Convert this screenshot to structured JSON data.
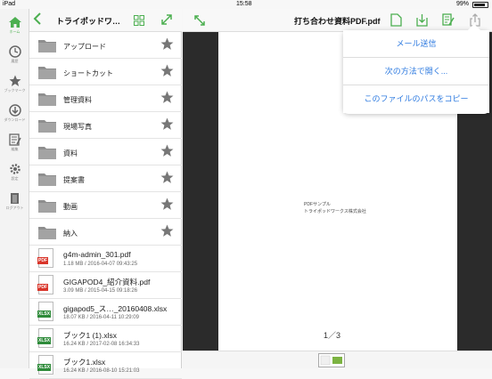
{
  "status": {
    "device": "iPad",
    "time": "15:58",
    "battery": "99%"
  },
  "sidebar": {
    "items": [
      {
        "label": "ホーム",
        "icon": "home-icon"
      },
      {
        "label": "履歴",
        "icon": "clock-icon"
      },
      {
        "label": "ブックマーク",
        "icon": "star-icon"
      },
      {
        "label": "ダウンロード",
        "icon": "download-icon"
      },
      {
        "label": "編集",
        "icon": "edit-icon"
      },
      {
        "label": "設定",
        "icon": "gear-icon"
      },
      {
        "label": "ログアウト",
        "icon": "logout-icon"
      }
    ],
    "accent": "#4caf50"
  },
  "filepane": {
    "title": "トライポッドワ…",
    "folders": [
      {
        "name": "アップロード"
      },
      {
        "name": "ショートカット"
      },
      {
        "name": "管理資料"
      },
      {
        "name": "現場写真"
      },
      {
        "name": "資料"
      },
      {
        "name": "提案書"
      },
      {
        "name": "動画"
      },
      {
        "name": "納入"
      }
    ],
    "files": [
      {
        "name": "g4m-admin_301.pdf",
        "meta": "1.18 MB / 2016-04-07 09:43:25",
        "type": "PDF"
      },
      {
        "name": "GIGAPOD4_紹介資料.pdf",
        "meta": "3.09 MB / 2015-04-15 09:18:26",
        "type": "PDF"
      },
      {
        "name": "gigapod5_ス…_20160408.xlsx",
        "meta": "18.07 KB / 2016-04-11 10:29:09",
        "type": "XLSX"
      },
      {
        "name": "ブック1 (1).xlsx",
        "meta": "16.24 KB / 2017-02-08 16:34:33",
        "type": "XLSX"
      },
      {
        "name": "ブック1.xlsx",
        "meta": "16.24 KB / 2016-08-10 15:21:03",
        "type": "XLSX"
      }
    ]
  },
  "viewer": {
    "title": "打ち合わせ資料PDF.pdf",
    "page_text_1": "PDFサンプル",
    "page_text_2": "トライポッドワークス株式会社",
    "page_indicator": "1／3"
  },
  "popover": {
    "items": [
      "メール送信",
      "次の方法で開く...",
      "このファイルのパスをコピー"
    ]
  }
}
